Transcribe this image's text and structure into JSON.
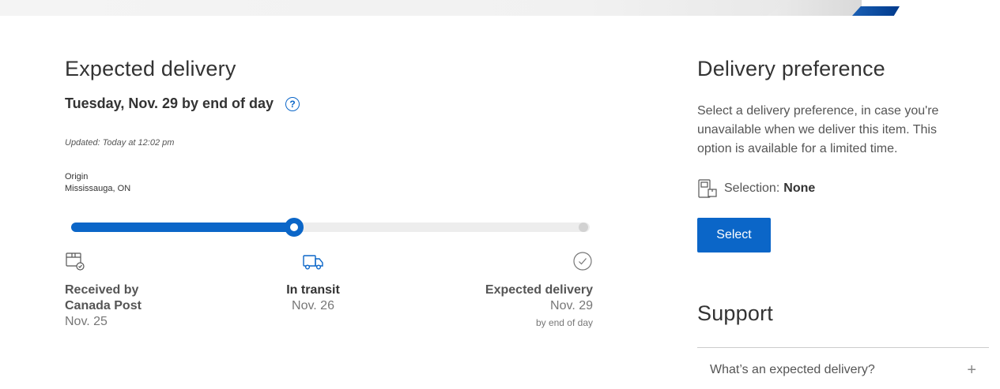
{
  "expected": {
    "title": "Expected delivery",
    "date": "Tuesday, Nov. 29 by end of day",
    "updated": "Updated: Today at 12:02 pm",
    "origin_label": "Origin",
    "origin_value": "Mississauga, ON",
    "progress_fraction": 0.43,
    "steps": [
      {
        "label": "Received by Canada Post",
        "date": "Nov. 25",
        "icon": "package-check-icon"
      },
      {
        "label": "In transit",
        "date": "Nov. 26",
        "icon": "truck-icon"
      },
      {
        "label": "Expected delivery",
        "date": "Nov. 29",
        "sub": "by end of day",
        "icon": "check-circle-icon"
      }
    ]
  },
  "preference": {
    "title": "Delivery preference",
    "description": "Select a delivery preference, in case you're unavailable when we deliver this item. This option is available for a limited time.",
    "selection_label": "Selection:",
    "selection_value": "None",
    "select_button": "Select"
  },
  "support": {
    "title": "Support",
    "faq": "What’s an expected delivery?"
  },
  "colors": {
    "accent": "#0b66c8",
    "track": "#ededed"
  }
}
